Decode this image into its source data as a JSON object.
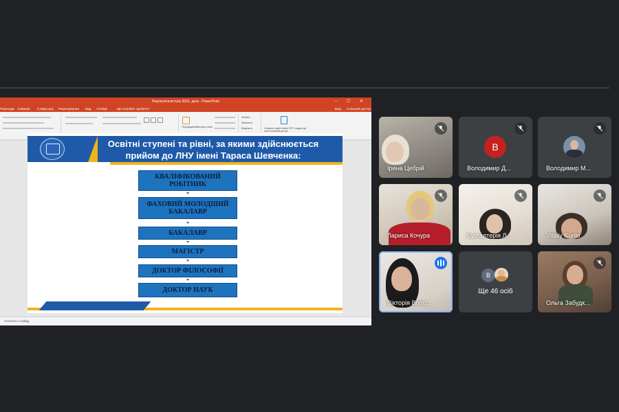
{
  "powerpoint": {
    "title": "Результати вступу 2022, дата · PowerPoint",
    "window_controls": "– ☐ ✕",
    "tabs": [
      "Переходи",
      "Анімація",
      "Слайд-шоу",
      "Рецензування",
      "Вид",
      "Acrobat",
      "Що потрібно зробити?"
    ],
    "login": "Вхід",
    "share": "Спільний доступ",
    "ribbon_groups": [
      "Абзац",
      "Малювання",
      "Редагування",
      "Adobe Acrobat"
    ],
    "ribbon_items": [
      "Знайти",
      "Замінити",
      "Виділити",
      "Упорядкувати",
      "Експрес-стилі"
    ],
    "adobe_text": "Створити файл Adobe PDF і надати до нього спільний доступ",
    "status_text": "Нотатки к слайду"
  },
  "slide": {
    "title": "Освітні ступені та рівні, за якими здійснюється прийом до ЛНУ імені Тараса Шевченка:",
    "levels": [
      "КВАЛІФІКОВАНИЙ РОБІТНИК",
      "ФАХОВИЙ МОЛОДШИЙ БАКАЛАВР",
      "БАКАЛАВР",
      "МАГІСТР",
      "ДОКТОР ФІЛОСОФІЇ",
      "ДОКТОР НАУК"
    ]
  },
  "participants": [
    {
      "name": "Ірина Цебрій",
      "muted": true
    },
    {
      "name": "Володимир Д...",
      "initial": "B",
      "avatar_color": "#c5221f",
      "muted": true
    },
    {
      "name": "Володимир М...",
      "muted": true
    },
    {
      "name": "Лариса Кочура",
      "muted": true
    },
    {
      "name": "Бухгалтерія Л...",
      "muted": true
    },
    {
      "name": "Vitaliy Kurilo",
      "muted": true
    },
    {
      "name": "Вікторія Воло...",
      "speaking": true
    },
    {
      "name": "Ще 46 осіб",
      "initial": "B"
    },
    {
      "name": "Ольга Забудк...",
      "muted": true
    }
  ]
}
